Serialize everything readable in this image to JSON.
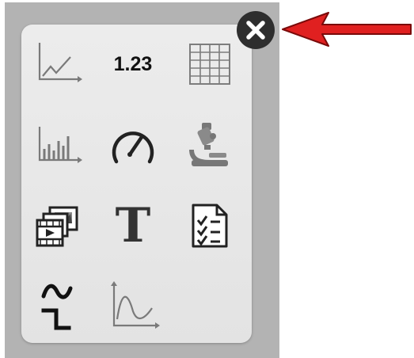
{
  "palette": {
    "items": [
      {
        "name": "line-chart",
        "icon": "line-chart-icon"
      },
      {
        "name": "numeric-value",
        "icon": "digital-display-icon",
        "label": "1.23"
      },
      {
        "name": "table",
        "icon": "table-grid-icon"
      },
      {
        "name": "bar-chart",
        "icon": "bar-chart-icon"
      },
      {
        "name": "gauge",
        "icon": "gauge-icon"
      },
      {
        "name": "microscope",
        "icon": "microscope-icon"
      },
      {
        "name": "media",
        "icon": "media-icon"
      },
      {
        "name": "text",
        "icon": "text-icon",
        "label": "T"
      },
      {
        "name": "checklist",
        "icon": "checklist-icon"
      },
      {
        "name": "signal-generator",
        "icon": "waveform-icon"
      },
      {
        "name": "curve-chart",
        "icon": "curve-chart-icon"
      }
    ]
  },
  "close_button": {
    "icon": "close-icon"
  },
  "annotation": {
    "icon": "red-arrow-icon",
    "color": "#e02020"
  },
  "colors": {
    "backdrop": "#b3b3b3",
    "panel": "#e8e8e8",
    "icon_gray": "#777777",
    "icon_dark": "#222222",
    "close_bg": "#2e2e2e"
  }
}
